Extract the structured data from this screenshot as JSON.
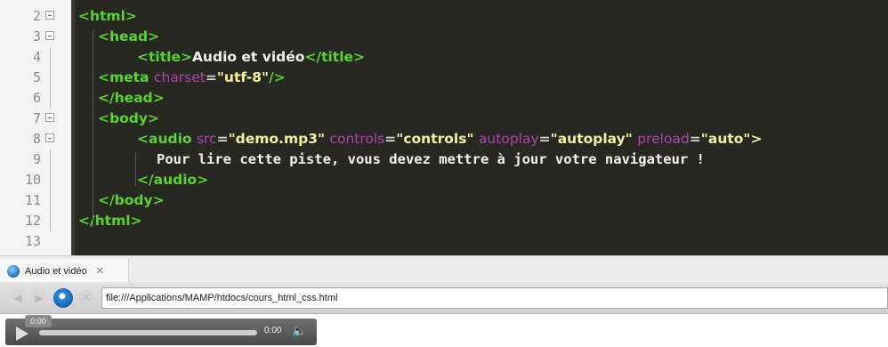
{
  "editor": {
    "lines": [
      {
        "n": "2",
        "segments": [
          {
            "t": "tag",
            "v": "<html>"
          }
        ]
      },
      {
        "n": "3",
        "segments": [
          {
            "t": "tag",
            "v": "<head>"
          }
        ]
      },
      {
        "n": "4",
        "segments": [
          {
            "t": "tag",
            "v": "<title>"
          },
          {
            "t": "txt",
            "v": "Audio et vidéo"
          },
          {
            "t": "tag",
            "v": "</title>"
          }
        ]
      },
      {
        "n": "5",
        "segments": [
          {
            "t": "tag",
            "v": "<meta "
          },
          {
            "t": "attr",
            "v": "charset"
          },
          {
            "t": "eq",
            "v": "="
          },
          {
            "t": "str",
            "v": "\"utf-8\""
          },
          {
            "t": "tag",
            "v": "/>"
          }
        ]
      },
      {
        "n": "6",
        "segments": [
          {
            "t": "tag",
            "v": "</head>"
          }
        ]
      },
      {
        "n": "7",
        "segments": [
          {
            "t": "tag",
            "v": "<body>"
          }
        ]
      },
      {
        "n": "8",
        "segments": [
          {
            "t": "tag",
            "v": "<audio "
          },
          {
            "t": "attr",
            "v": "src"
          },
          {
            "t": "eq",
            "v": "="
          },
          {
            "t": "str",
            "v": "\"demo.mp3\" "
          },
          {
            "t": "attr",
            "v": "controls"
          },
          {
            "t": "eq",
            "v": "="
          },
          {
            "t": "str",
            "v": "\"controls\" "
          },
          {
            "t": "attr",
            "v": "autoplay"
          },
          {
            "t": "eq",
            "v": "="
          },
          {
            "t": "str",
            "v": "\"autoplay\" "
          },
          {
            "t": "attr",
            "v": "preload"
          },
          {
            "t": "eq",
            "v": "="
          },
          {
            "t": "str",
            "v": "\"auto\">"
          }
        ]
      },
      {
        "n": "9",
        "segments": [
          {
            "t": "mono",
            "v": "Pour lire cette piste, vous devez mettre à jour votre navigateur !"
          }
        ]
      },
      {
        "n": "10",
        "segments": [
          {
            "t": "tag",
            "v": "</audio>"
          }
        ]
      },
      {
        "n": "11",
        "segments": [
          {
            "t": "tag",
            "v": "</body>"
          }
        ]
      },
      {
        "n": "12",
        "segments": [
          {
            "t": "tag",
            "v": "</html>"
          }
        ]
      },
      {
        "n": "13",
        "segments": []
      }
    ],
    "colors": {
      "background": "#272822",
      "tag": "#59d42f",
      "attribute": "#b43fb2",
      "string": "#f5f0a0",
      "text": "#f2f2f2"
    }
  },
  "browser": {
    "tab_title": "Audio et vidéo",
    "tab_close": "✕",
    "url": "file:///Applications/MAMP/htdocs/cours_html_css.html",
    "back_icon": "back-arrow-icon",
    "forward_icon": "forward-arrow-icon",
    "browser_icon": "internet-explorer-icon"
  },
  "player": {
    "time_bubble": "0:00",
    "time": "0:00",
    "progress": 0
  }
}
